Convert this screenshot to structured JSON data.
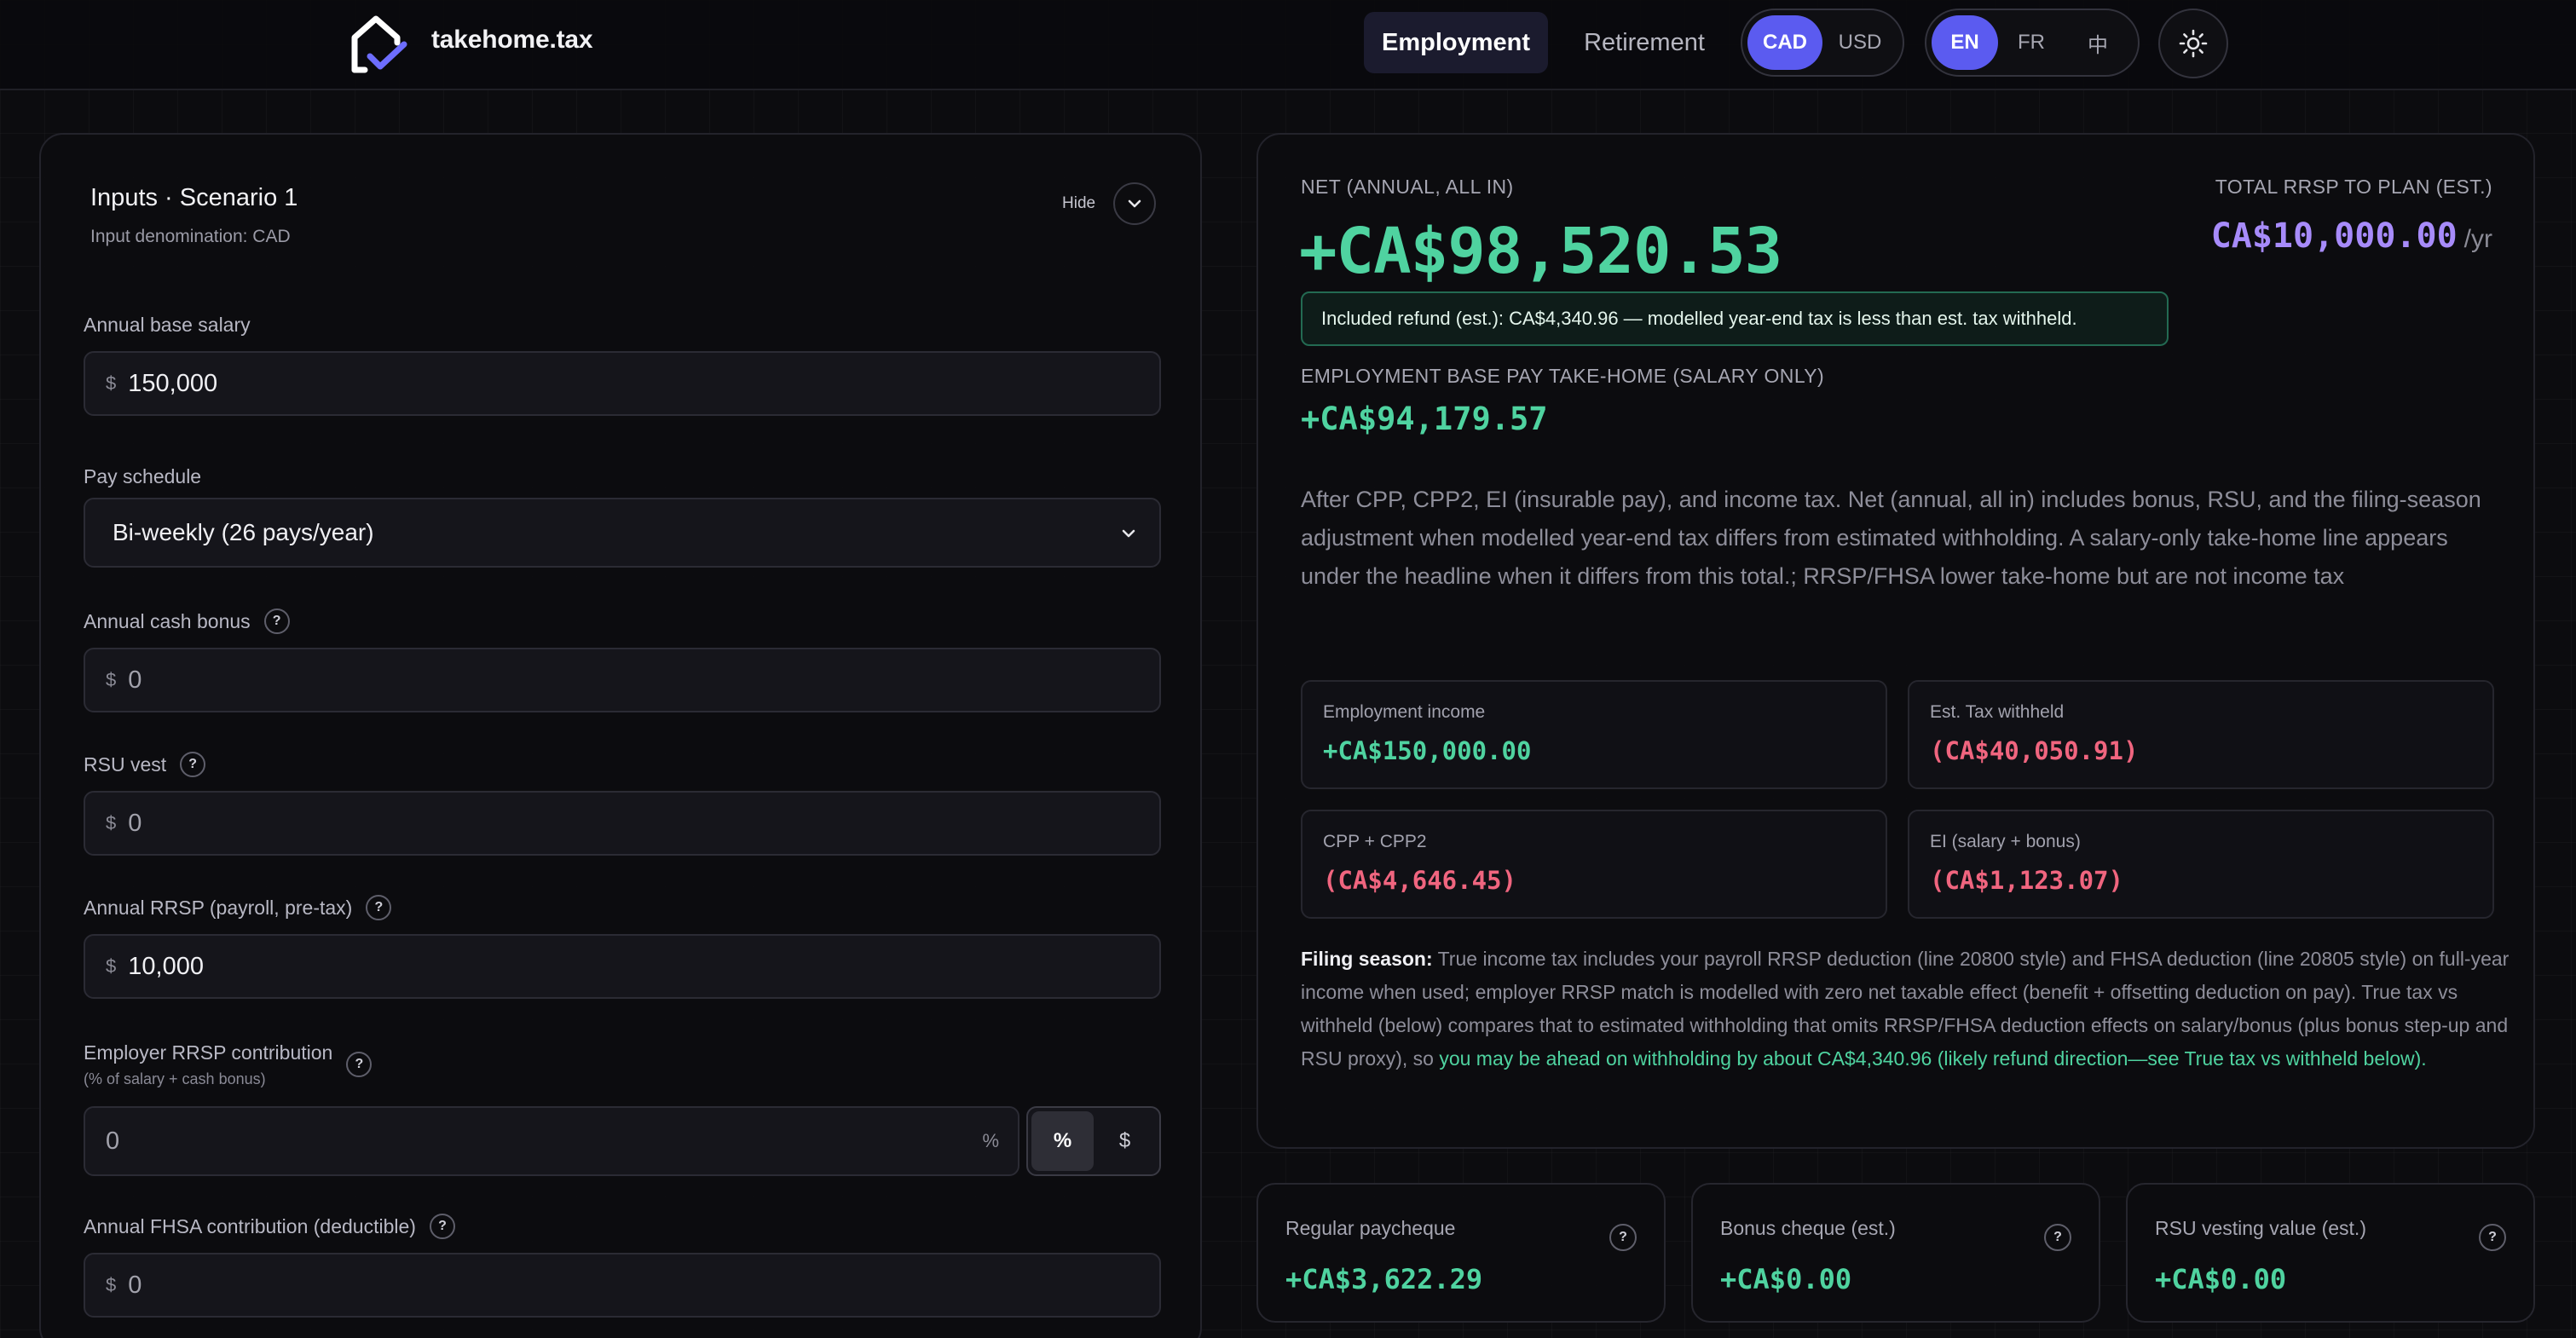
{
  "header": {
    "brand": "takehome.tax",
    "nav": {
      "employment": "Employment",
      "retirement": "Retirement"
    },
    "currency": {
      "options": [
        "CAD",
        "USD"
      ],
      "selected": "CAD"
    },
    "language": {
      "options": [
        "EN",
        "FR",
        "中"
      ],
      "selected": "EN"
    },
    "icons": {
      "logo": "house-check-logo",
      "theme": "sun-icon"
    }
  },
  "inputs": {
    "title": "Inputs · Scenario 1",
    "denomination": "Input denomination: CAD",
    "hide_label": "Hide",
    "currency_symbol": "$",
    "fields": {
      "salary": {
        "label": "Annual base salary",
        "value": "150,000"
      },
      "pay_schedule": {
        "label": "Pay schedule",
        "value": "Bi-weekly (26 pays/year)"
      },
      "bonus": {
        "label": "Annual cash bonus",
        "value": "0"
      },
      "rsu": {
        "label": "RSU vest",
        "value": "0"
      },
      "rrsp": {
        "label": "Annual RRSP (payroll, pre-tax)",
        "value": "10,000"
      },
      "employer_rrsp": {
        "label": "Employer RRSP contribution",
        "sublabel": "(% of salary + cash bonus)",
        "value": "0",
        "suffix": "%",
        "modes": [
          "%",
          "$"
        ],
        "selected_mode": "%"
      },
      "fhsa": {
        "label": "Annual FHSA contribution (deductible)",
        "value": "0"
      }
    },
    "help_glyph": "?"
  },
  "results": {
    "net_label": "NET (ANNUAL, ALL IN)",
    "net_value": "+CA$98,520.53",
    "rrsp_label": "TOTAL RRSP TO PLAN (EST.)",
    "rrsp_value": "CA$10,000.00",
    "rrsp_unit": "/yr",
    "refund_note": "Included refund (est.): CA$4,340.96 — modelled year-end tax is less than est. tax withheld.",
    "base_label": "EMPLOYMENT BASE PAY TAKE-HOME (SALARY ONLY)",
    "base_value": "+CA$94,179.57",
    "description": "After CPP, CPP2, EI (insurable pay), and income tax. Net (annual, all in) includes bonus, RSU, and the filing-season adjustment when modelled year-end tax differs from estimated withholding. A salary-only take-home line appears under the headline when it differs from this total.; RRSP/FHSA lower take-home but are not income tax",
    "breakdown": [
      {
        "label": "Employment income",
        "value": "+CA$150,000.00",
        "sign": "pos"
      },
      {
        "label": "Est. Tax withheld",
        "value": "(CA$40,050.91)",
        "sign": "neg"
      },
      {
        "label": "CPP + CPP2",
        "value": "(CA$4,646.45)",
        "sign": "neg"
      },
      {
        "label": "EI (salary + bonus)",
        "value": "(CA$1,123.07)",
        "sign": "neg"
      }
    ],
    "filing": {
      "lead": "Filing season:",
      "body": " True income tax includes your payroll RRSP deduction (line 20800 style) and FHSA deduction (line 20805 style) on full-year income when used; employer RRSP match is modelled with zero net taxable effect (benefit + offsetting deduction on pay). True tax vs withheld (below) compares that to estimated withholding that omits RRSP/FHSA deduction effects on salary/bonus (plus bonus step-up and RSU proxy), so ",
      "highlight": "you may be ahead on withholding by about CA$4,340.96 (likely refund direction—see True tax vs withheld below)."
    }
  },
  "pay_cards": [
    {
      "label": "Regular paycheque",
      "value": "+CA$3,622.29"
    },
    {
      "label": "Bonus cheque (est.)",
      "value": "+CA$0.00"
    },
    {
      "label": "RSU vesting value (est.)",
      "value": "+CA$0.00"
    }
  ],
  "colors": {
    "accent": "#5b5bf0",
    "positive": "#4fd3a0",
    "negative": "#f0657f",
    "rrsp": "#a78bfa",
    "background": "#0c0c0f"
  }
}
